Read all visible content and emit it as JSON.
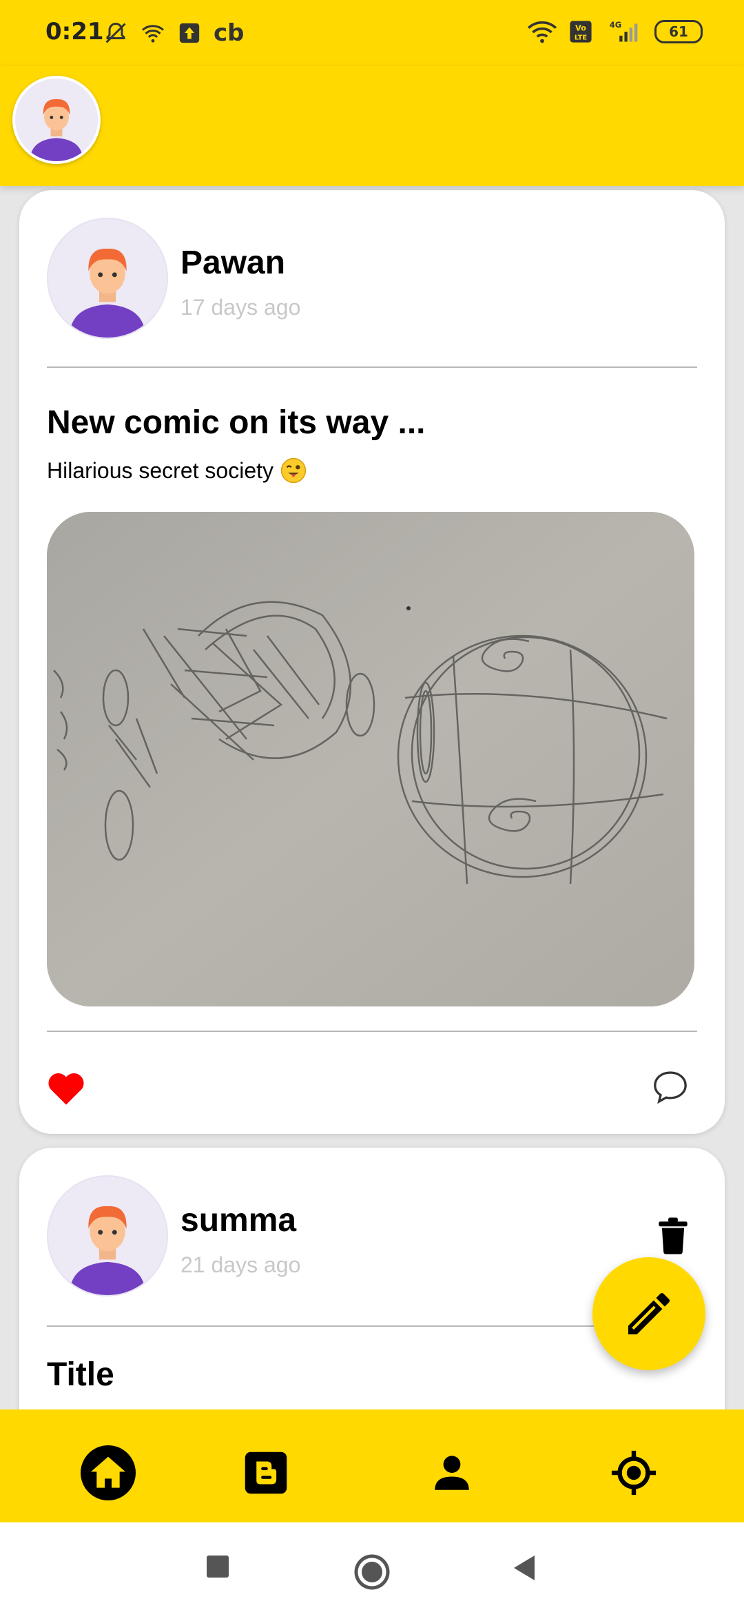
{
  "status_bar": {
    "time": "0:21",
    "carrier_label": "cb",
    "network": "4G",
    "volte": "Vo LTE",
    "battery": "61"
  },
  "app": {
    "accent_color": "#FFD900",
    "profile_icon": "user-avatar-icon"
  },
  "posts": [
    {
      "author": "Pawan",
      "time_ago": "17 days ago",
      "title": "New comic on its way ...",
      "body": "Hilarious secret society",
      "liked": true
    },
    {
      "author": "summa",
      "time_ago": "21 days ago",
      "title": "Title"
    }
  ],
  "bottom_nav": {
    "items": [
      "home-icon",
      "blogger-icon",
      "person-icon",
      "location-icon"
    ],
    "active_index": 0
  },
  "fab_icon": "pencil-icon"
}
